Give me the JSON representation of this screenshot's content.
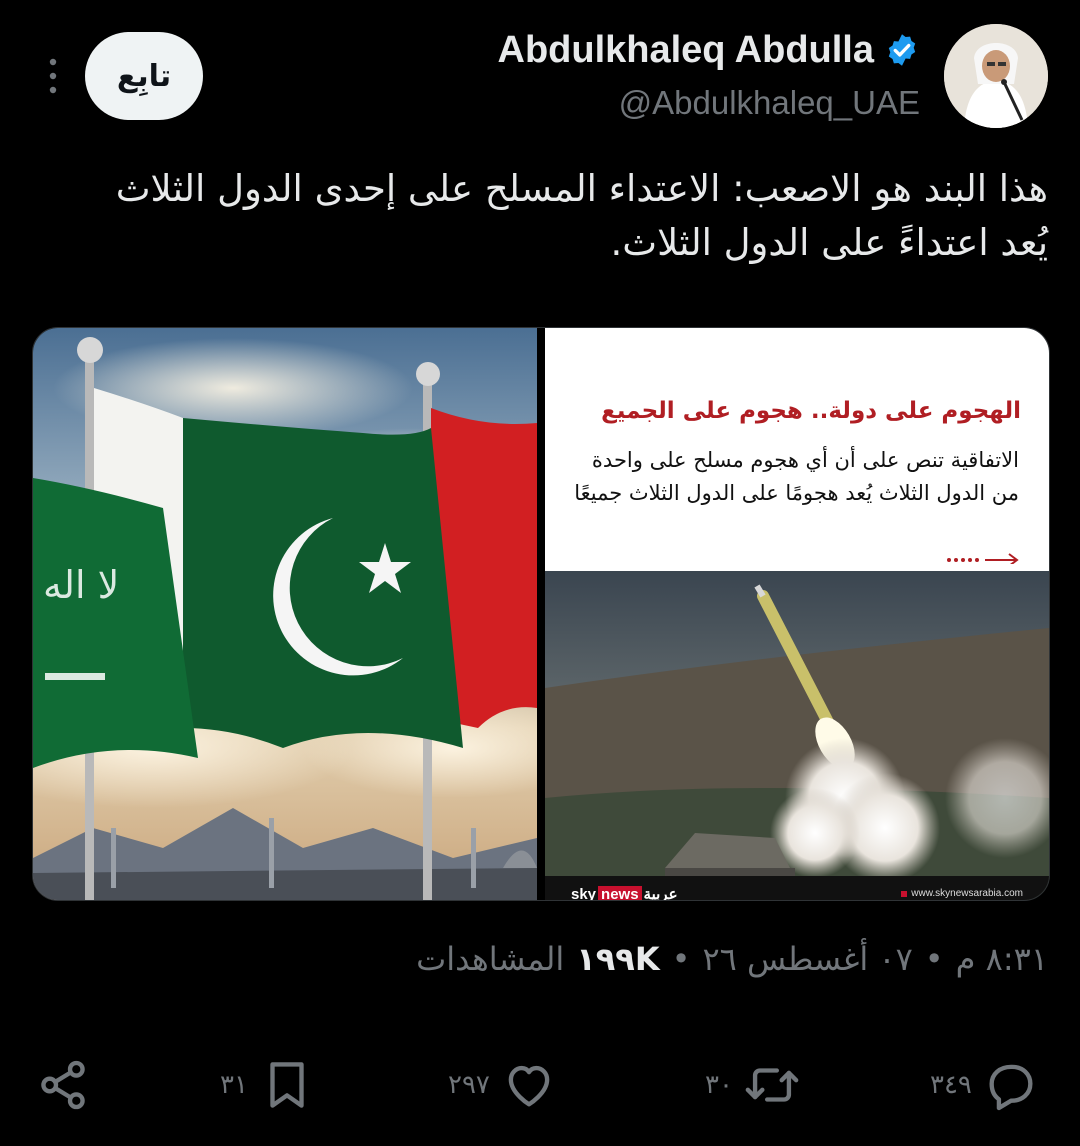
{
  "author": {
    "display_name": "Abdulkhaleq Abdulla",
    "handle": "@Abdulkhaleq_UAE",
    "verified": true
  },
  "follow_label": "تابِع",
  "tweet": {
    "text_line1": "هذا البند هو الاصعب: الاعتداء المسلح على إحدى الدول الثلاث",
    "text_line2": "يُعد اعتداءً على الدول الثلاث."
  },
  "media": {
    "card_headline": "الهجوم على دولة.. هجوم على الجميع",
    "card_body": "الاتفاقية تنص على أن أي هجوم مسلح على واحدة من الدول الثلاث يُعد هجومًا على الدول الثلاث جميعًا",
    "logo_text": "عربية",
    "logo_sky": "sky",
    "logo_news": "news",
    "watermark_url": "www.skynewsarabia.com"
  },
  "meta": {
    "time": "٨:٣١ م",
    "date": "٠٧ أغسطس ٢٦",
    "views_count": "١٩٩K",
    "views_label": "المشاهدات",
    "separator": "•"
  },
  "actions": {
    "replies": "٣٤٩",
    "retweets": "٣٠",
    "likes": "٢٩٧",
    "bookmarks": "٣١"
  },
  "colors": {
    "background": "#000000",
    "text": "#e7e9ea",
    "muted": "#71767b",
    "verified": "#1d9bf0",
    "headline_red": "#b01e23"
  }
}
